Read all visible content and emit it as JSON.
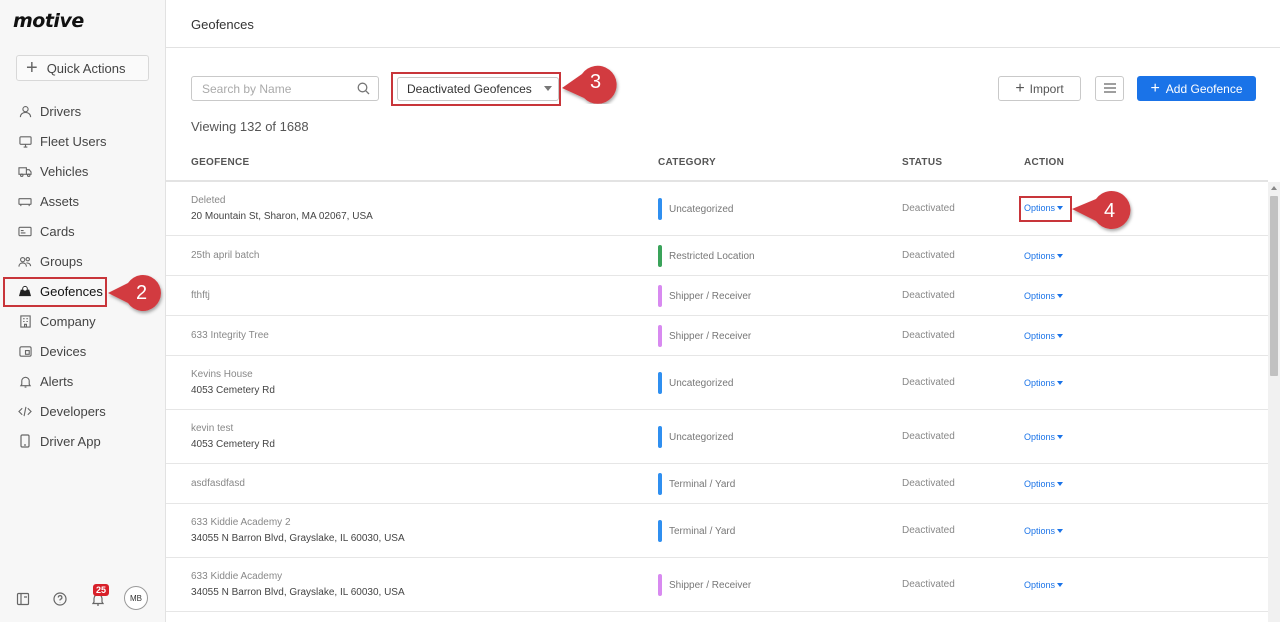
{
  "app": {
    "logo": "motive"
  },
  "sidebar": {
    "quick_actions_label": "Quick Actions",
    "items": [
      {
        "label": "Drivers",
        "icon": "person-icon"
      },
      {
        "label": "Fleet Users",
        "icon": "monitor-icon"
      },
      {
        "label": "Vehicles",
        "icon": "truck-icon"
      },
      {
        "label": "Assets",
        "icon": "trailer-icon"
      },
      {
        "label": "Cards",
        "icon": "card-icon"
      },
      {
        "label": "Groups",
        "icon": "group-icon"
      },
      {
        "label": "Geofences",
        "icon": "geofence-icon",
        "active": true
      },
      {
        "label": "Company",
        "icon": "building-icon"
      },
      {
        "label": "Devices",
        "icon": "device-icon"
      },
      {
        "label": "Alerts",
        "icon": "bell-icon"
      },
      {
        "label": "Developers",
        "icon": "code-icon"
      },
      {
        "label": "Driver App",
        "icon": "phone-icon"
      }
    ],
    "notification_count": "25",
    "avatar_initials": "MB"
  },
  "header": {
    "title": "Geofences"
  },
  "toolbar": {
    "search_placeholder": "Search by Name",
    "filter_value": "Deactivated Geofences",
    "import_label": "Import",
    "add_label": "Add Geofence"
  },
  "viewing_text": "Viewing 132 of 1688",
  "table": {
    "columns": [
      "GEOFENCE",
      "CATEGORY",
      "STATUS",
      "ACTION"
    ],
    "rows": [
      {
        "name": "Deleted",
        "address": "20 Mountain St, Sharon, MA 02067, USA",
        "category": "Uncategorized",
        "category_color": "#2f8ff0",
        "status": "Deactivated",
        "action": "Options"
      },
      {
        "name": "25th april batch",
        "address": "",
        "category": "Restricted Location",
        "category_color": "#3aa35a",
        "status": "Deactivated",
        "action": "Options"
      },
      {
        "name": "fthftj",
        "address": "",
        "category": "Shipper / Receiver",
        "category_color": "#d88af0",
        "status": "Deactivated",
        "action": "Options"
      },
      {
        "name": "633 Integrity Tree",
        "address": "",
        "category": "Shipper / Receiver",
        "category_color": "#d88af0",
        "status": "Deactivated",
        "action": "Options"
      },
      {
        "name": "Kevins House",
        "address": "4053 Cemetery Rd",
        "category": "Uncategorized",
        "category_color": "#2f8ff0",
        "status": "Deactivated",
        "action": "Options"
      },
      {
        "name": "kevin test",
        "address": "4053 Cemetery Rd",
        "category": "Uncategorized",
        "category_color": "#2f8ff0",
        "status": "Deactivated",
        "action": "Options"
      },
      {
        "name": "asdfasdfasd",
        "address": "",
        "category": "Terminal / Yard",
        "category_color": "#2f8ff0",
        "status": "Deactivated",
        "action": "Options"
      },
      {
        "name": "633 Kiddie Academy 2",
        "address": "34055 N Barron Blvd, Grayslake, IL 60030, USA",
        "category": "Terminal / Yard",
        "category_color": "#2f8ff0",
        "status": "Deactivated",
        "action": "Options"
      },
      {
        "name": "633 Kiddie Academy",
        "address": "34055 N Barron Blvd, Grayslake, IL 60030, USA",
        "category": "Shipper / Receiver",
        "category_color": "#d88af0",
        "status": "Deactivated",
        "action": "Options"
      }
    ]
  },
  "callouts": [
    "2",
    "3",
    "4"
  ],
  "colors": {
    "accent": "#1a73e8",
    "callout": "#c8353a"
  }
}
